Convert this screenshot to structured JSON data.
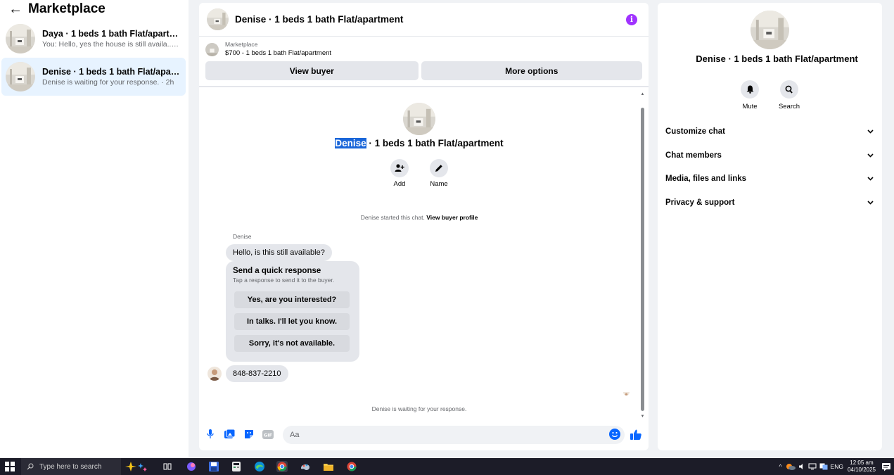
{
  "left": {
    "back_glyph": "←",
    "title": "Marketplace",
    "conversations": [
      {
        "name": "Daya · 1 beds 1 bath Flat/apartment",
        "preview": "You: Hello, yes the house is still availa... · 1m"
      },
      {
        "name": "Denise · 1 beds 1 bath Flat/apartment",
        "preview": "Denise is waiting for your response. · 2h"
      }
    ]
  },
  "chat": {
    "header_title": "Denise · 1 beds 1 bath Flat/apartment",
    "info_glyph": "i",
    "marketplace_label": "Marketplace",
    "listing_summary": "$700 - 1 beds 1 bath Flat/apartment",
    "view_buyer": "View buyer",
    "more_options": "More options",
    "thread_title_selected": "Denise",
    "thread_title_rest": " · 1 beds 1 bath Flat/apartment",
    "add_label": "Add",
    "name_label": "Name",
    "started_text": "Denise started this chat.",
    "started_link": "View buyer profile",
    "sender": "Denise",
    "first_message": "Hello, is this still available?",
    "quick_title": "Send a quick response",
    "quick_sub": "Tap a response to send it to the buyer.",
    "quick_options": [
      "Yes, are you interested?",
      "In talks. I'll let you know.",
      "Sorry, it's not available."
    ],
    "phone_message": "848-837-2210",
    "waiting_text": "Denise is waiting for your response.",
    "composer_placeholder": "Aa"
  },
  "right": {
    "title": "Denise · 1 beds 1 bath Flat/apartment",
    "mute_label": "Mute",
    "search_label": "Search",
    "sections": [
      "Customize chat",
      "Chat members",
      "Media, files and links",
      "Privacy & support"
    ]
  },
  "taskbar": {
    "search_placeholder": "Type here to search",
    "lang": "ENG",
    "time": "12:05 am",
    "date": "04/10/2025"
  },
  "colors": {
    "accent": "#0866ff",
    "info": "#a033ff",
    "active_row": "#e7f3ff",
    "selection": "#1a66d9"
  }
}
